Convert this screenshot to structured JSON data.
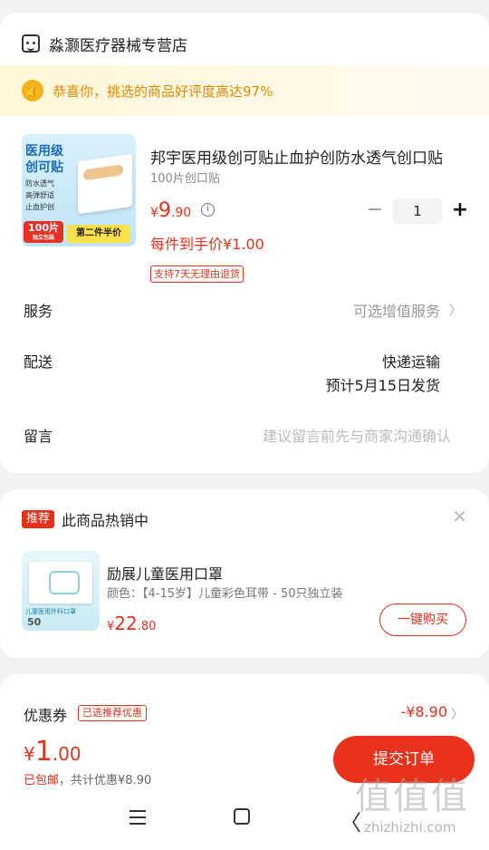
{
  "store": {
    "name": "淼灏医疗器械专营店",
    "icon": "store-icon"
  },
  "praise": {
    "text": "恭喜你，挑选的商品好评度高达97%",
    "icon": "thumbs-up-icon"
  },
  "product": {
    "image_text": {
      "title1": "医用级",
      "title2": "创可贴",
      "feat1": "防水透气",
      "feat2": "高弹舒适",
      "feat3": "止血护创",
      "badge": "100片",
      "badge_sub": "独立包装",
      "promo": "第二件半价"
    },
    "title": "邦宇医用级创可贴止血护创防水透气创口贴",
    "spec": "100片创口贴",
    "price_symbol": "¥",
    "price_int": "9",
    "price_dec": ".90",
    "quantity": "1",
    "unit_price": "每件到手价¥1.00",
    "return_policy": "支持7天无理由退货"
  },
  "rows": {
    "service": {
      "label": "服务",
      "value": "可选增值服务"
    },
    "delivery": {
      "label": "配送",
      "value": "快递运输",
      "eta": "预计5月15日发货"
    },
    "message": {
      "label": "留言",
      "placeholder": "建议留言前先与商家沟通确认"
    }
  },
  "recommend": {
    "badge": "推荐",
    "title": "此商品热销中",
    "item": {
      "image_text": {
        "label": "儿童医用外科口罩",
        "count": "50"
      },
      "name": "励展儿童医用口罩",
      "spec": "颜色：【4-15岁】儿童彩色耳带 - 50只独立装",
      "price_symbol": "¥",
      "price_int": "22",
      "price_dec": ".80",
      "buy_label": "一键购买"
    }
  },
  "coupon": {
    "label": "优惠券",
    "tag": "已选推荐优惠",
    "amount": "-¥8.90"
  },
  "footer": {
    "total_symbol": "¥",
    "total_int": "1",
    "total_dec": ".00",
    "shipping": "已包邮",
    "discount_prefix": "，共计优惠",
    "discount": "¥8.90",
    "submit_label": "提交订单"
  },
  "watermark": {
    "glyphs": "值值值",
    "site": "zhizhizhi.com"
  },
  "colors": {
    "accent": "#e5311b",
    "praise": "#e08a00",
    "background": "#f2f2f2"
  }
}
